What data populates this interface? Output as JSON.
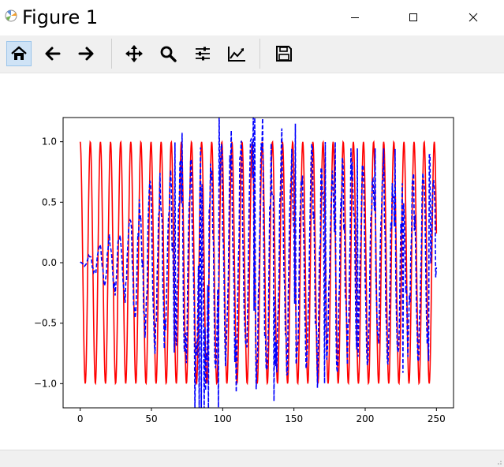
{
  "window": {
    "title": "Figure 1",
    "controls": [
      "minimize",
      "maximize",
      "close"
    ]
  },
  "toolbar": {
    "buttons": [
      {
        "name": "home",
        "icon": "home-icon",
        "active": true
      },
      {
        "name": "back",
        "icon": "arrow-left-icon",
        "active": false
      },
      {
        "name": "forward",
        "icon": "arrow-right-icon",
        "active": false
      },
      {
        "name": "pan",
        "icon": "move-icon",
        "active": false
      },
      {
        "name": "zoom",
        "icon": "magnifier-icon",
        "active": false
      },
      {
        "name": "configure-subplots",
        "icon": "sliders-icon",
        "active": false
      },
      {
        "name": "edit-axes",
        "icon": "line-chart-icon",
        "active": false
      },
      {
        "name": "save",
        "icon": "floppy-disk-icon",
        "active": false
      }
    ]
  },
  "chart_data": {
    "type": "line",
    "title": "",
    "xlabel": "",
    "ylabel": "",
    "xlim": [
      -12,
      262
    ],
    "ylim": [
      -1.2,
      1.2
    ],
    "xticks": [
      "0",
      "50",
      "100",
      "150",
      "200",
      "250"
    ],
    "yticks": [
      "−1.0",
      "−0.5",
      "0.0",
      "0.5",
      "1.0"
    ],
    "grid": false,
    "legend": null,
    "series": [
      {
        "style": "solid",
        "color": "#ff0000",
        "description": "cosine carrier, amplitude 1.0, about 7.1 samples per cycle over x = 0..250",
        "x_range": [
          0,
          250
        ],
        "amplitude": 1.0,
        "period": 7.1
      },
      {
        "style": "dashed",
        "color": "#0000ff",
        "description": "noisy reconstruction, amplitude grows from ~0 at x=0 to ~1.2 around x=100–130, settles near ±0.9 later",
        "x_range": [
          0,
          250
        ],
        "points": [
          [
            0,
            0.0
          ],
          [
            10,
            0.12
          ],
          [
            20,
            0.25
          ],
          [
            30,
            0.35
          ],
          [
            40,
            0.6
          ],
          [
            50,
            0.75
          ],
          [
            60,
            0.85
          ],
          [
            70,
            1.0
          ],
          [
            80,
            1.15
          ],
          [
            90,
            1.15
          ],
          [
            100,
            1.2
          ],
          [
            110,
            1.2
          ],
          [
            120,
            1.2
          ],
          [
            130,
            1.15
          ],
          [
            140,
            1.05
          ],
          [
            150,
            1.1
          ],
          [
            160,
            1.05
          ],
          [
            170,
            0.95
          ],
          [
            180,
            0.95
          ],
          [
            190,
            0.9
          ],
          [
            200,
            0.9
          ],
          [
            210,
            0.9
          ],
          [
            220,
            0.9
          ],
          [
            230,
            0.85
          ],
          [
            240,
            0.85
          ],
          [
            250,
            0.85
          ]
        ]
      }
    ]
  },
  "status": {
    "text": ""
  }
}
